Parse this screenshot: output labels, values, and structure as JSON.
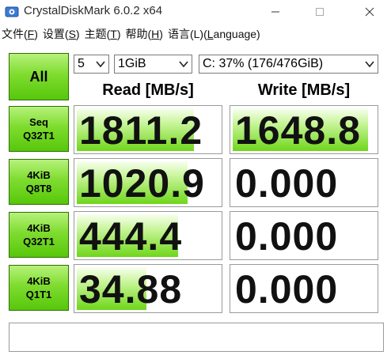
{
  "window": {
    "title": "CrystalDiskMark 6.0.2 x64",
    "controls": [
      "minimize-icon",
      "maximize-icon",
      "close-icon"
    ]
  },
  "menu": {
    "items": [
      {
        "pre": "文件(",
        "key": "F",
        "post": ")"
      },
      {
        "pre": "设置(",
        "key": "S",
        "post": ")"
      },
      {
        "pre": "主题(",
        "key": "T",
        "post": ")"
      },
      {
        "pre": "帮助(",
        "key": "H",
        "post": ")"
      },
      {
        "pre": "语言(L)(",
        "key": "L",
        "post": "anguage)"
      }
    ]
  },
  "controls": {
    "all_label": "All",
    "count_value": "5",
    "size_value": "1GiB",
    "drive_value": "C: 37% (176/476GiB)"
  },
  "headers": {
    "read": "Read [MB/s]",
    "write": "Write [MB/s]"
  },
  "rows": [
    {
      "line1": "Seq",
      "line2": "Q32T1",
      "read": "1811.2",
      "write": "1648.8",
      "read_level": 0.82,
      "write_level": 0.95
    },
    {
      "line1": "4KiB",
      "line2": "Q8T8",
      "read": "1020.9",
      "write": "0.000",
      "read_level": 0.78,
      "write_level": 0
    },
    {
      "line1": "4KiB",
      "line2": "Q32T1",
      "read": "444.4",
      "write": "0.000",
      "read_level": 0.71,
      "write_level": 0
    },
    {
      "line1": "4KiB",
      "line2": "Q1T1",
      "read": "34.88",
      "write": "0.000",
      "read_level": 0.49,
      "write_level": 0
    }
  ],
  "status_text": "",
  "colors": {
    "button_green": "#57c70b",
    "bar_green": "#6fd61a",
    "border": "#9a9a9a"
  }
}
